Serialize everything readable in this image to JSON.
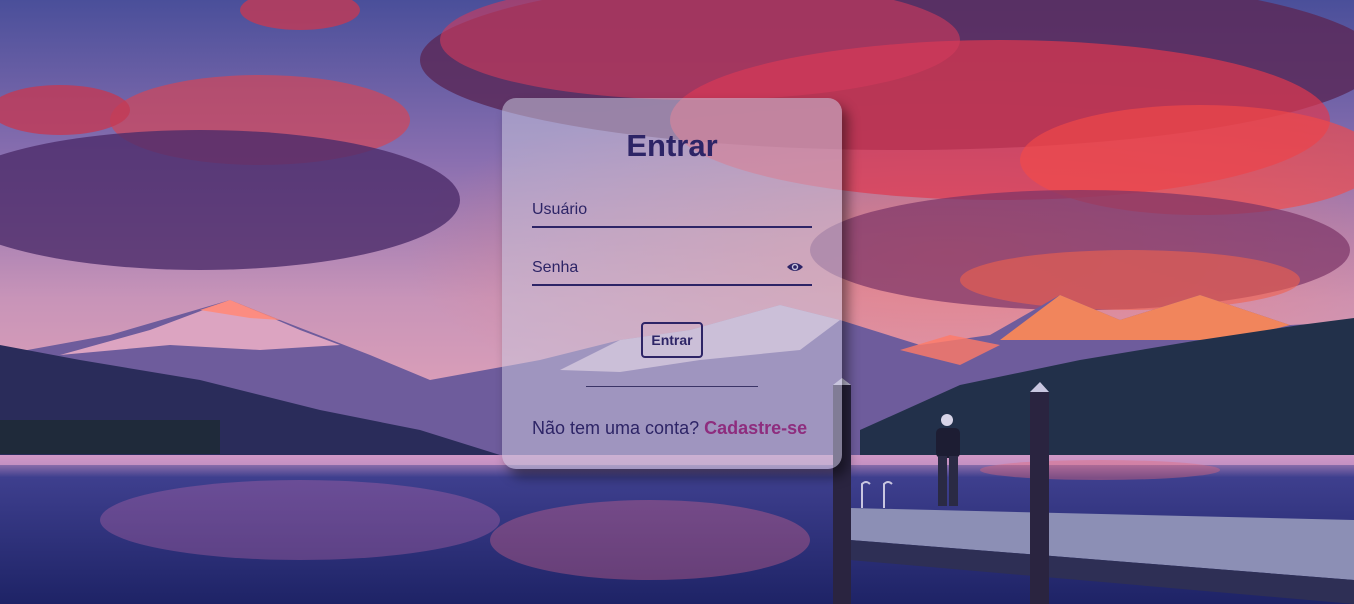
{
  "login": {
    "title": "Entrar",
    "username_placeholder": "Usuário",
    "password_placeholder": "Senha",
    "submit_label": "Entrar",
    "signup_prompt": "Não tem uma conta?",
    "signup_link": "Cadastre-se"
  },
  "icons": {
    "password_toggle": "eye-icon"
  },
  "colors": {
    "primary": "#2d2466",
    "link": "#8e2d7e",
    "card": "rgba(200,196,220,0.55)"
  }
}
